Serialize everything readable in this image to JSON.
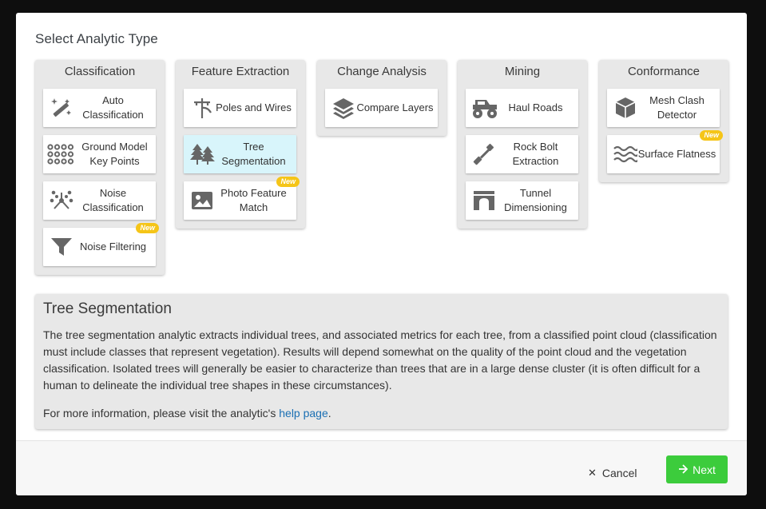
{
  "dialog": {
    "title": "Select Analytic Type"
  },
  "columns": [
    {
      "title": "Classification",
      "cards": [
        {
          "label": "Auto Classification",
          "icon": "magic-wand-icon",
          "new": false
        },
        {
          "label": "Ground Model Key Points",
          "icon": "dot-grid-icon",
          "new": false
        },
        {
          "label": "Noise Classification",
          "icon": "scatter-icon",
          "new": false
        },
        {
          "label": "Noise Filtering",
          "icon": "funnel-icon",
          "new": true
        }
      ]
    },
    {
      "title": "Feature Extraction",
      "cards": [
        {
          "label": "Poles and Wires",
          "icon": "utility-pole-icon",
          "new": false
        },
        {
          "label": "Tree Segmentation",
          "icon": "trees-icon",
          "new": false,
          "selected": true
        },
        {
          "label": "Photo Feature Match",
          "icon": "image-icon",
          "new": true
        }
      ]
    },
    {
      "title": "Change Analysis",
      "cards": [
        {
          "label": "Compare Layers",
          "icon": "layers-icon",
          "new": false
        }
      ]
    },
    {
      "title": "Mining",
      "cards": [
        {
          "label": "Haul Roads",
          "icon": "monster-truck-icon",
          "new": false
        },
        {
          "label": "Rock Bolt Extraction",
          "icon": "bolt-icon",
          "new": false
        },
        {
          "label": "Tunnel Dimensioning",
          "icon": "tunnel-icon",
          "new": false
        }
      ]
    },
    {
      "title": "Conformance",
      "cards": [
        {
          "label": "Mesh Clash Detector",
          "icon": "cube-icon",
          "new": false
        },
        {
          "label": "Surface Flatness",
          "icon": "waves-icon",
          "new": true
        }
      ]
    }
  ],
  "badge_label": "New",
  "info": {
    "title": "Tree Segmentation",
    "description": "The tree segmentation analytic extracts individual trees, and associated metrics for each tree, from a classified point cloud (classification must include classes that represent vegetation). Results will depend somewhat on the quality of the point cloud and the vegetation classification. Isolated trees will generally be easier to characterize than trees that are in a large dense cluster (it is often difficult for a human to delineate the individual tree shapes in these circumstances).",
    "more_prefix": "For more information, please visit the analytic's ",
    "more_link": "help page",
    "more_suffix": "."
  },
  "footer": {
    "cancel_label": "Cancel",
    "next_label": "Next"
  },
  "colors": {
    "selected": "#d8f5fb",
    "next": "#3ccc3c",
    "badge": "#f5c518",
    "link": "#1a6fb3"
  }
}
